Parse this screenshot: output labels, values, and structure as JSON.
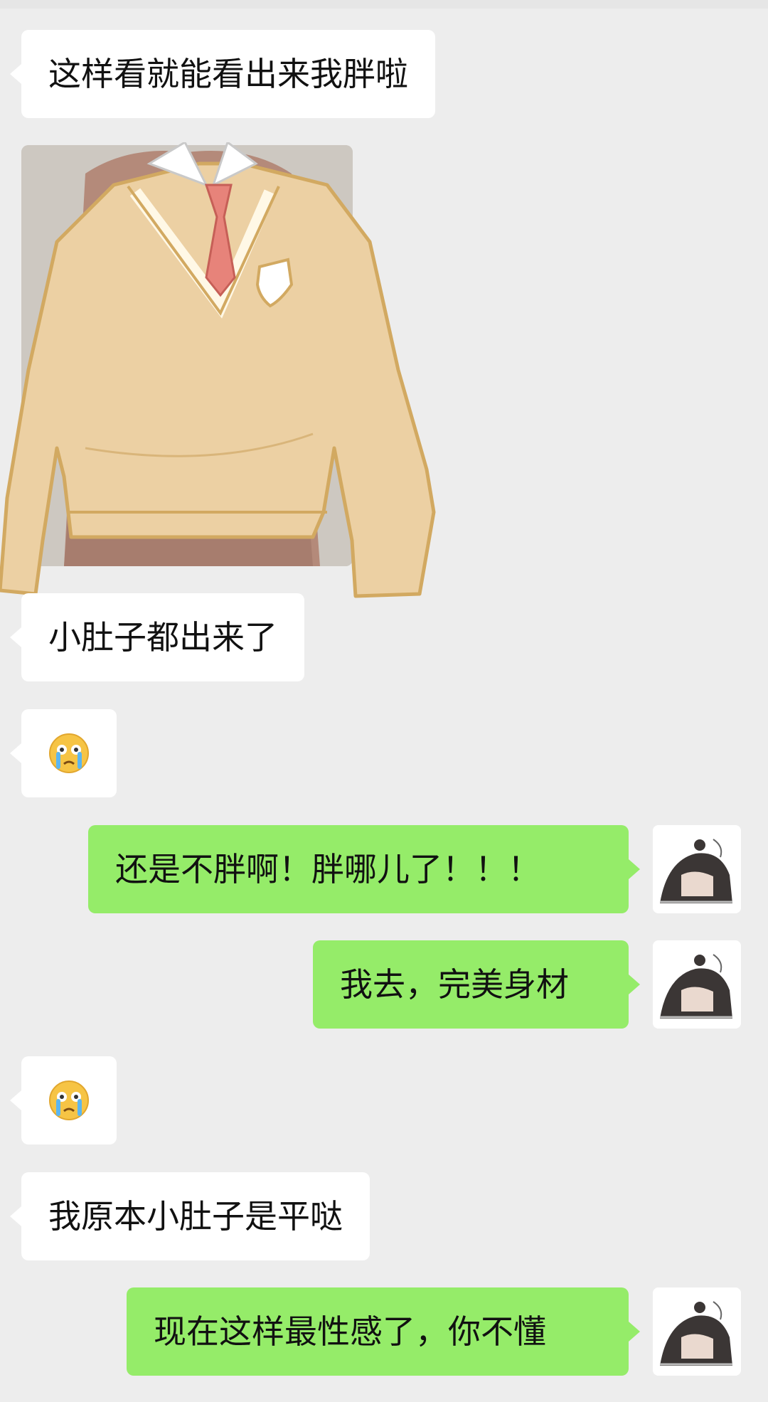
{
  "messages": [
    {
      "side": "left",
      "type": "text",
      "text": "这样看就能看出来我胖啦"
    },
    {
      "side": "left",
      "type": "image",
      "image": "photo-with-sweater-sticker"
    },
    {
      "side": "left",
      "type": "text",
      "text": "小肚子都出来了"
    },
    {
      "side": "left",
      "type": "emoji",
      "emoji": "crying-face-emoji"
    },
    {
      "side": "right",
      "type": "text",
      "text": "还是不胖啊！胖哪儿了！！！"
    },
    {
      "side": "right",
      "type": "text",
      "text": "我去，完美身材"
    },
    {
      "side": "left",
      "type": "emoji",
      "emoji": "crying-face-emoji"
    },
    {
      "side": "left",
      "type": "text",
      "text": "我原本小肚子是平哒"
    },
    {
      "side": "right",
      "type": "text",
      "text": "现在这样最性感了，你不懂"
    }
  ],
  "colors": {
    "background": "#ededed",
    "incoming_bubble": "#ffffff",
    "outgoing_bubble": "#95ec69",
    "text": "#111111"
  },
  "icons": {
    "self_avatar": "anime-character-avatar",
    "emoji": "crying-face-emoji"
  }
}
